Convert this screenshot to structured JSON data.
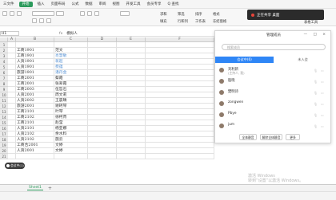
{
  "menubar": {
    "items": [
      "三文件",
      "",
      "",
      "",
      "开始",
      "插入",
      "页面布局",
      "公式",
      "数据",
      "审阅",
      "视图",
      "开发工具",
      "会员专享",
      "",
      "Q 查找"
    ]
  },
  "toolbar": {
    "labels": [
      "求和",
      "筛选",
      "排序",
      "格式",
      "填充",
      "行和列",
      "工作表",
      "冻结窗格",
      "表格工具"
    ]
  },
  "meeting_pill": {
    "text": "正在共享 桌面"
  },
  "formula": {
    "cell_ref": "H1",
    "fx": "fx",
    "value": "模拟人"
  },
  "columns": [
    "A",
    "B",
    "C",
    "D",
    "E",
    "F"
  ],
  "rows": [
    {
      "n": "1",
      "b": "",
      "c": "",
      "d": ""
    },
    {
      "n": "2",
      "b": "工商1901",
      "c": "范文"
    },
    {
      "n": "3",
      "b": "工商1901",
      "c": "肖慧敏",
      "blue": true
    },
    {
      "n": "4",
      "b": "人资1901",
      "c": "蒋超",
      "blue": true
    },
    {
      "n": "5",
      "b": "人资1901",
      "c": "费蕴",
      "blue": true
    },
    {
      "n": "6",
      "b": "旅游1901",
      "c": "潘丹金",
      "blue": true
    },
    {
      "n": "7",
      "b": "工商2001",
      "c": "蔡霞"
    },
    {
      "n": "8",
      "b": "工商2001",
      "c": "张翠霞"
    },
    {
      "n": "9",
      "b": "工商2003",
      "c": "伍哲石"
    },
    {
      "n": "10",
      "b": "人资2001",
      "c": "周文莉"
    },
    {
      "n": "11",
      "b": "人资2002",
      "c": "王晨晴"
    },
    {
      "n": "12",
      "b": "旅游2001",
      "c": "谢珂琴"
    },
    {
      "n": "13",
      "b": "工商2101",
      "c": "叶琴"
    },
    {
      "n": "14",
      "b": "工商2102",
      "c": "徐柯宵"
    },
    {
      "n": "15",
      "b": "工商2101",
      "c": "赵莹"
    },
    {
      "n": "16",
      "b": "人资2101",
      "c": "杨亚娜"
    },
    {
      "n": "17",
      "b": "人资2102",
      "c": "余水料"
    },
    {
      "n": "18",
      "b": "人资2102",
      "c": "施云"
    },
    {
      "n": "19",
      "b": "工商合2001",
      "c": "文婷"
    },
    {
      "n": "20",
      "b": "人资2001",
      "c": "文婷"
    },
    {
      "n": "21",
      "b": "",
      "c": ""
    }
  ],
  "float_avatar": {
    "label": "会议中(1)"
  },
  "sheet": {
    "tab": "Sheet1",
    "add": "+"
  },
  "watermark": {
    "line1": "激活 Windows",
    "line2": "转到“设置”以激活 Windows。"
  },
  "panel": {
    "title": "管理成员",
    "controls": "— □ ×",
    "search_placeholder": "搜索成员",
    "tab_in": "会议中(6)",
    "tab_out": "未入会",
    "members": [
      {
        "name": "刘利新",
        "sub": "(主持人, 我)"
      },
      {
        "name": "殷晓",
        "sub": ""
      },
      {
        "name": "樊明诗",
        "sub": ""
      },
      {
        "name": "zongwen",
        "sub": ""
      },
      {
        "name": "Pbye",
        "sub": ""
      },
      {
        "name": "jum",
        "sub": ""
      }
    ],
    "buttons": [
      "全体静音",
      "解除全体静音",
      "更多"
    ]
  }
}
